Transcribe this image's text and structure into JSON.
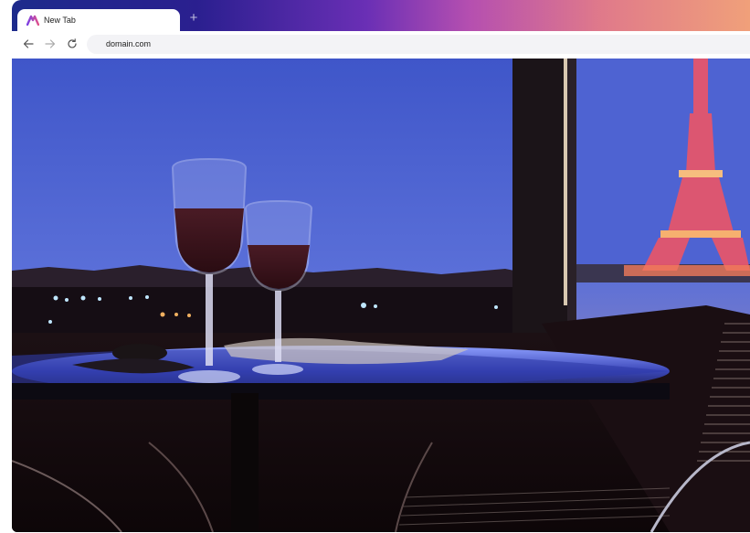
{
  "browser": {
    "tab": {
      "title": "New Tab",
      "favicon": "browser-logo-icon"
    },
    "new_tab_label": "+",
    "nav": {
      "back": "arrow-left-icon",
      "forward": "arrow-right-icon",
      "reload": "reload-icon"
    },
    "address": {
      "url": "domain.com"
    }
  },
  "content": {
    "image": "photo-wine-glasses-eiffel-tower-night"
  },
  "colors": {
    "gradient_start": "#1d2b8c",
    "gradient_mid": "#6a2fb5",
    "gradient_end": "#f0a07a",
    "sky": "#4a5fd0",
    "tower": "#e0566a"
  }
}
